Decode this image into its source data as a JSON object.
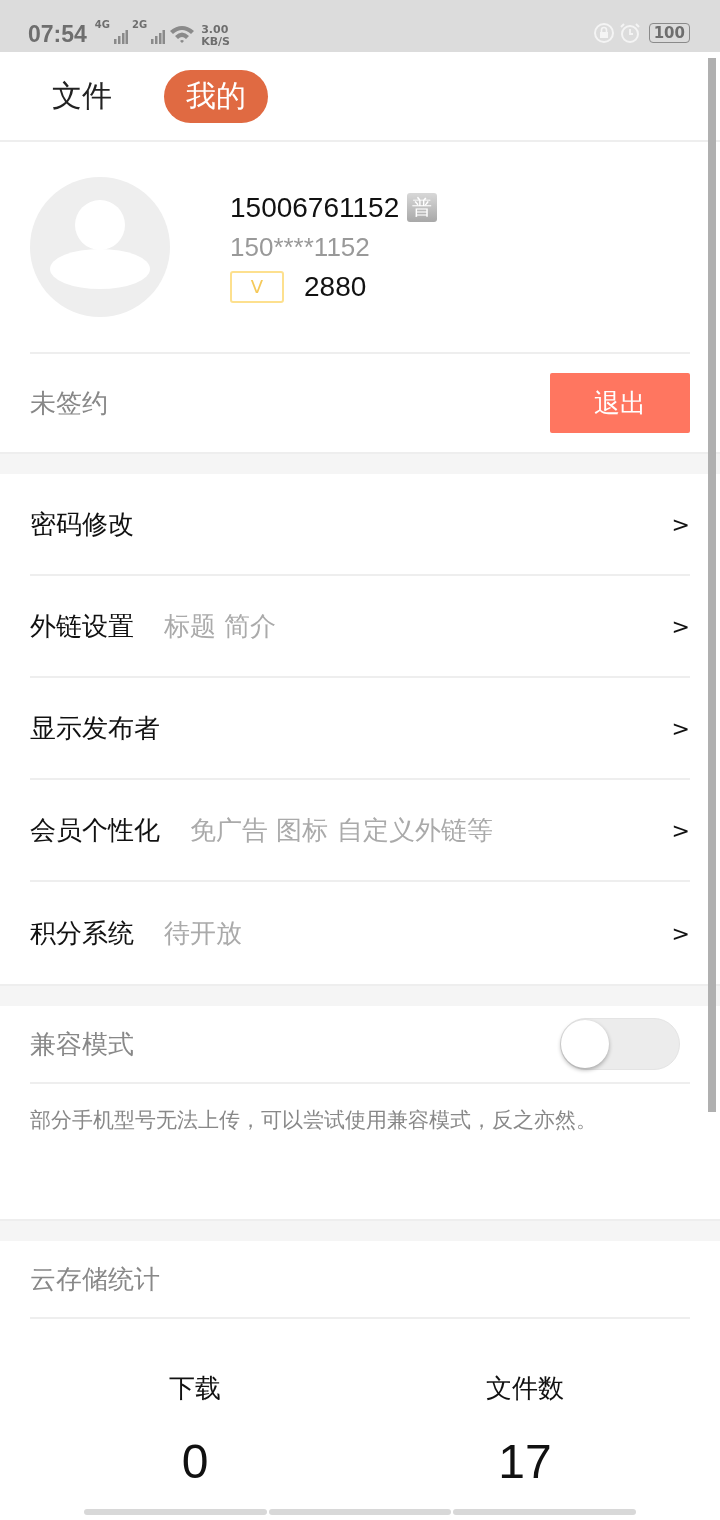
{
  "status_bar": {
    "time": "07:54",
    "network_1": "4G",
    "network_2": "2G",
    "speed": "3.00",
    "speed_unit": "KB/S",
    "battery": "100"
  },
  "tabs": [
    {
      "label": "文件",
      "selected": false
    },
    {
      "label": "我的",
      "selected": true
    }
  ],
  "profile": {
    "name": "15006761152",
    "badge": "普",
    "masked_phone": "150****1152",
    "vip_label": "V",
    "points": "2880"
  },
  "sign": {
    "status": "未签约",
    "logout_button": "退出"
  },
  "menu": [
    {
      "label": "密码修改",
      "chevron": ">"
    },
    {
      "label": "外链设置",
      "hint": "标题 简介",
      "chevron": ">"
    },
    {
      "label": "显示发布者",
      "chevron": ">"
    },
    {
      "label": "会员个性化",
      "hint": "免广告 图标 自定义外链等",
      "chevron": ">"
    },
    {
      "label": "积分系统",
      "hint": "待开放",
      "chevron": ">"
    }
  ],
  "compat": {
    "label": "兼容模式",
    "on": false,
    "description": "部分手机型号无法上传，可以尝试使用兼容模式，反之亦然。"
  },
  "cloud_stats": {
    "title": "云存储统计",
    "stats": [
      {
        "label": "下载",
        "value": "0"
      },
      {
        "label": "文件数",
        "value": "17"
      }
    ]
  }
}
